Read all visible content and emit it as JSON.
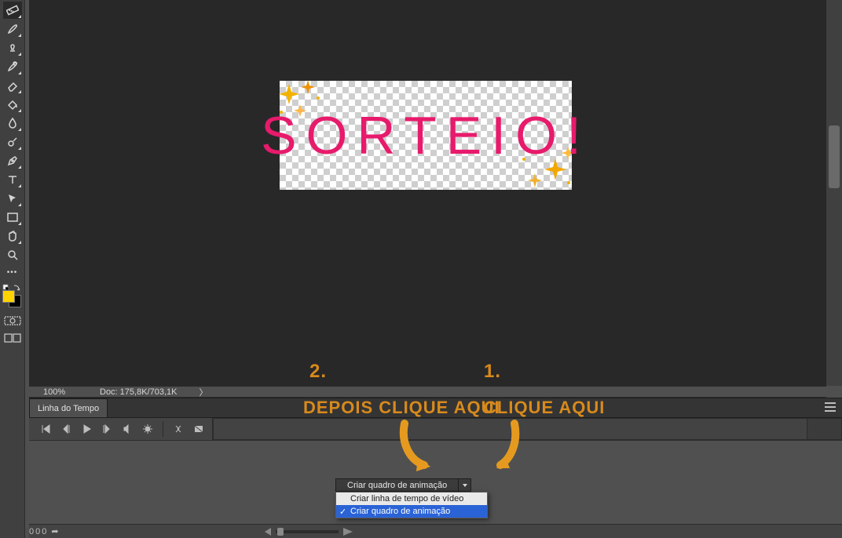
{
  "tools": [
    {
      "name": "ruler-icon",
      "interact": true
    },
    {
      "name": "move-tool-icon",
      "interact": true
    },
    {
      "name": "brush-tool-icon",
      "interact": true
    },
    {
      "name": "stamp-tool-icon",
      "interact": true
    },
    {
      "name": "history-brush-icon",
      "interact": true
    },
    {
      "name": "eraser-tool-icon",
      "interact": true
    },
    {
      "name": "paint-bucket-icon",
      "interact": true
    },
    {
      "name": "blur-tool-icon",
      "interact": true
    },
    {
      "name": "dodge-tool-icon",
      "interact": true
    },
    {
      "name": "pen-tool-icon",
      "interact": true
    },
    {
      "name": "type-tool-icon",
      "interact": true
    },
    {
      "name": "path-selection-icon",
      "interact": true
    },
    {
      "name": "rectangle-tool-icon",
      "interact": true
    },
    {
      "name": "hand-tool-icon",
      "interact": true
    },
    {
      "name": "zoom-tool-icon",
      "interact": true
    }
  ],
  "canvas": {
    "text": "SORTEIO!"
  },
  "statusbar": {
    "zoom": "100%",
    "doc": "Doc: 175,8K/703,1K"
  },
  "timeline": {
    "tab": "Linha do Tempo",
    "create_button": "Criar quadro de animação",
    "menu_option_video": "Criar linha de tempo de vídeo",
    "menu_option_frame": "Criar quadro de animação",
    "footer_frames": "000"
  },
  "annot": {
    "num1": "1.",
    "num2": "2.",
    "txt1": "CLIQUE AQUI",
    "txt2": "DEPOIS CLIQUE AQUI"
  },
  "colors": {
    "foreground": "#ffd300",
    "background": "#000000"
  }
}
